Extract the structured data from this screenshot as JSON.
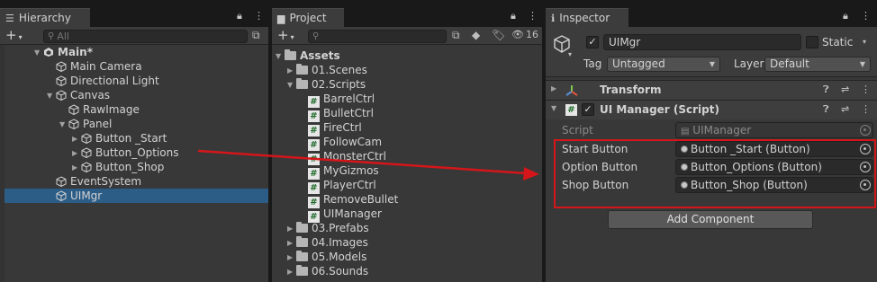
{
  "hierarchy": {
    "tab_label": "Hierarchy",
    "lock_icon": "lock-icon",
    "search_placeholder": "All",
    "items": [
      {
        "label": "Main*",
        "depth": 0,
        "expanded": true,
        "icon": "unity-scene-icon",
        "bold": true
      },
      {
        "label": "Main Camera",
        "depth": 1,
        "expanded": null,
        "icon": "cube-icon"
      },
      {
        "label": "Directional Light",
        "depth": 1,
        "expanded": null,
        "icon": "cube-icon"
      },
      {
        "label": "Canvas",
        "depth": 1,
        "expanded": true,
        "icon": "cube-icon"
      },
      {
        "label": "RawImage",
        "depth": 2,
        "expanded": null,
        "icon": "cube-icon"
      },
      {
        "label": "Panel",
        "depth": 2,
        "expanded": true,
        "icon": "cube-icon"
      },
      {
        "label": "Button _Start",
        "depth": 3,
        "expanded": false,
        "icon": "cube-icon"
      },
      {
        "label": "Button_Options",
        "depth": 3,
        "expanded": false,
        "icon": "cube-icon"
      },
      {
        "label": "Button_Shop",
        "depth": 3,
        "expanded": false,
        "icon": "cube-icon"
      },
      {
        "label": "EventSystem",
        "depth": 1,
        "expanded": null,
        "icon": "cube-icon"
      },
      {
        "label": "UIMgr",
        "depth": 1,
        "expanded": null,
        "icon": "cube-icon",
        "selected": true
      }
    ]
  },
  "project": {
    "tab_label": "Project",
    "hidden_count": "16",
    "items": [
      {
        "label": "Assets",
        "depth": 0,
        "expanded": true,
        "type": "folder",
        "bold": true
      },
      {
        "label": "01.Scenes",
        "depth": 1,
        "expanded": false,
        "type": "folder"
      },
      {
        "label": "02.Scripts",
        "depth": 1,
        "expanded": true,
        "type": "folder"
      },
      {
        "label": "BarrelCtrl",
        "depth": 2,
        "type": "script"
      },
      {
        "label": "BulletCtrl",
        "depth": 2,
        "type": "script"
      },
      {
        "label": "FireCtrl",
        "depth": 2,
        "type": "script"
      },
      {
        "label": "FollowCam",
        "depth": 2,
        "type": "script"
      },
      {
        "label": "MonsterCtrl",
        "depth": 2,
        "type": "script"
      },
      {
        "label": "MyGizmos",
        "depth": 2,
        "type": "script"
      },
      {
        "label": "PlayerCtrl",
        "depth": 2,
        "type": "script"
      },
      {
        "label": "RemoveBullet",
        "depth": 2,
        "type": "script"
      },
      {
        "label": "UIManager",
        "depth": 2,
        "type": "script"
      },
      {
        "label": "03.Prefabs",
        "depth": 1,
        "expanded": false,
        "type": "folder"
      },
      {
        "label": "04.Images",
        "depth": 1,
        "expanded": false,
        "type": "folder"
      },
      {
        "label": "05.Models",
        "depth": 1,
        "expanded": false,
        "type": "folder"
      },
      {
        "label": "06.Sounds",
        "depth": 1,
        "expanded": false,
        "type": "folder"
      }
    ]
  },
  "inspector": {
    "tab_label": "Inspector",
    "object_name": "UIMgr",
    "static_label": "Static",
    "tag_label": "Tag",
    "tag_value": "Untagged",
    "layer_label": "Layer",
    "layer_value": "Default",
    "transform": {
      "title": "Transform"
    },
    "script_component": {
      "title": "UI Manager (Script)",
      "script_label": "Script",
      "script_value": "UIManager",
      "props": [
        {
          "label": "Start Button",
          "value": "Button _Start (Button)"
        },
        {
          "label": "Option Button",
          "value": "Button_Options (Button)"
        },
        {
          "label": "Shop Button",
          "value": "Button_Shop (Button)"
        }
      ]
    },
    "add_component_label": "Add Component"
  },
  "annotation": {
    "color": "#d4161a"
  }
}
